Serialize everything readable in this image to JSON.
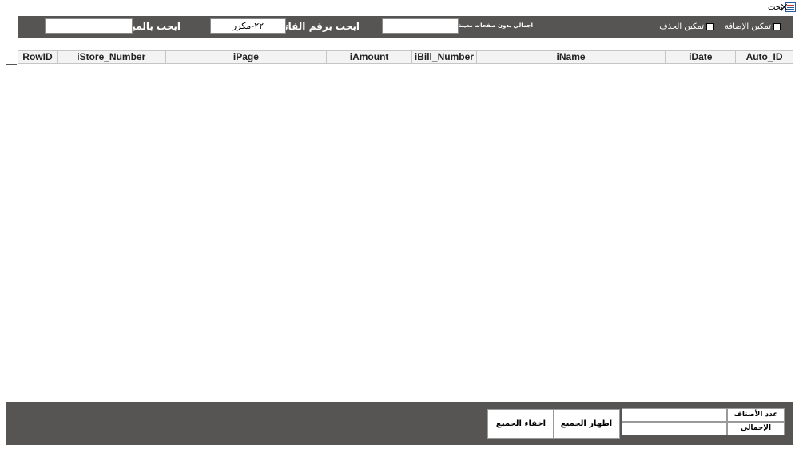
{
  "window": {
    "title": "بحث",
    "close_glyph": "×"
  },
  "header": {
    "enable_add_label": "تمكين الإضافة",
    "enable_delete_label": "تمكين الحذف",
    "total_without_pages_label": "اجمالي بدون صفحات معينة",
    "total_without_pages_value": "",
    "search_invoice_label": "ابحث برقم الفاتورة",
    "search_invoice_value": "٢٢-مكرر",
    "search_amount_label": "ابحث بالمبلغ",
    "search_amount_value": ""
  },
  "grid": {
    "columns": [
      "RowID",
      "iStore_Number",
      "iPage",
      "iAmount",
      "iBill_Number",
      "iName",
      "iDate",
      "Auto_ID"
    ],
    "rows": []
  },
  "footer": {
    "item_count_label": "عدد الأصناف",
    "item_count_value": "",
    "total_label": "الإجمالي",
    "total_value": "",
    "show_all_label": "اظهار الجميع",
    "hide_all_label": "اخفاء الجميع"
  },
  "colors": {
    "band": "#565553",
    "header_bg": "#f3f3f3"
  }
}
